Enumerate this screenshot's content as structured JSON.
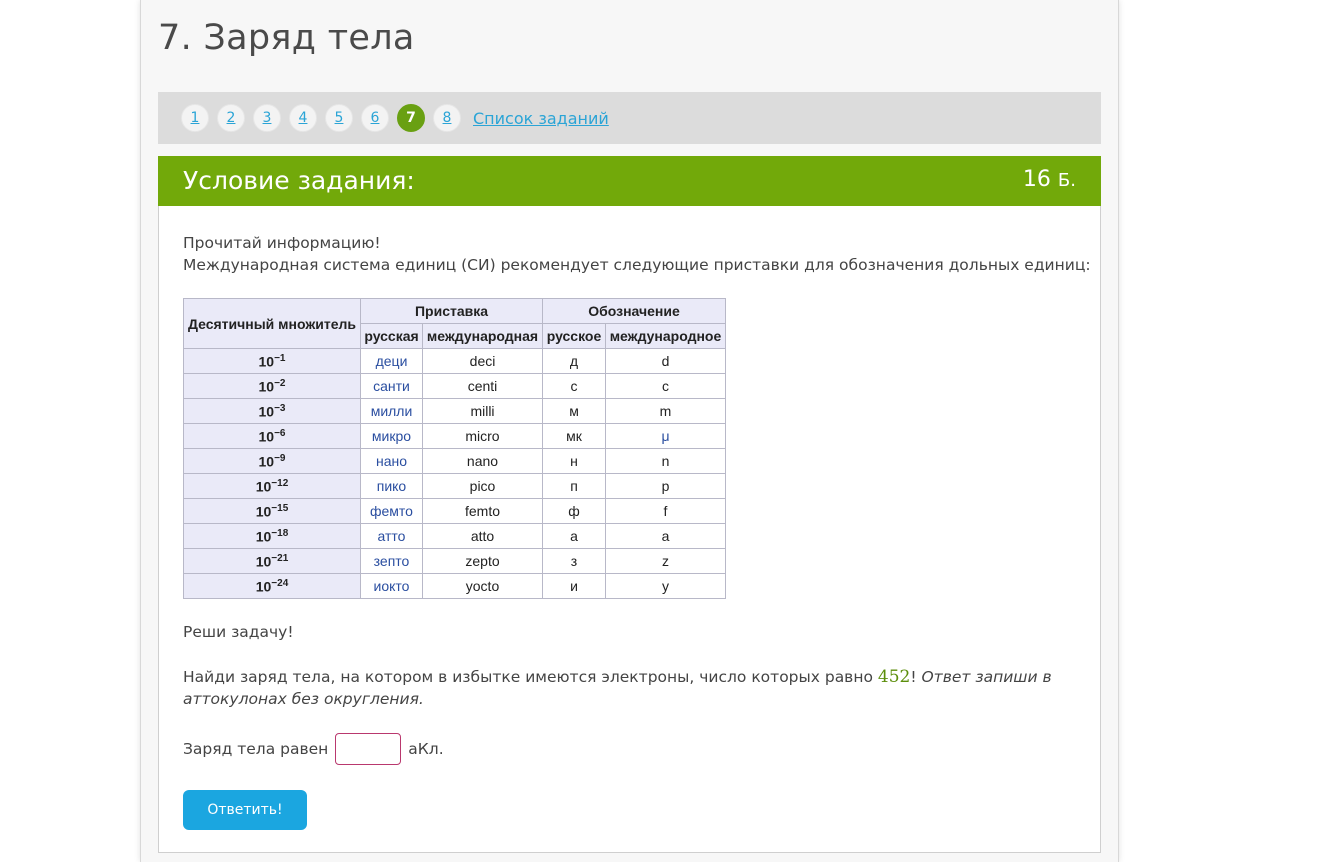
{
  "page": {
    "title": "7. Заряд тела"
  },
  "nav": {
    "items": [
      "1",
      "2",
      "3",
      "4",
      "5",
      "6",
      "7",
      "8"
    ],
    "active_index": 6,
    "list_link": "Список заданий"
  },
  "task": {
    "header_title": "Условие задания:",
    "score_value": "16",
    "score_unit": "Б.",
    "intro_line1": "Прочитай информацию!",
    "intro_line2": "Международная система единиц (СИ) рекомендует следующие приставки для обозначения дольных единиц:",
    "table": {
      "headers": {
        "multiplier": "Десятичный множитель",
        "prefix": "Приставка",
        "symbol": "Обозначение",
        "prefix_ru": "русская",
        "prefix_int": "международная",
        "symbol_ru": "русское",
        "symbol_int": "международное"
      },
      "rows": [
        {
          "base": "10",
          "exp": "−1",
          "ru": "деци",
          "int": "deci",
          "sym_ru": "д",
          "sym_int": "d"
        },
        {
          "base": "10",
          "exp": "−2",
          "ru": "санти",
          "int": "centi",
          "sym_ru": "с",
          "sym_int": "c"
        },
        {
          "base": "10",
          "exp": "−3",
          "ru": "милли",
          "int": "milli",
          "sym_ru": "м",
          "sym_int": "m"
        },
        {
          "base": "10",
          "exp": "−6",
          "ru": "микро",
          "int": "micro",
          "sym_ru": "мк",
          "sym_int": "μ"
        },
        {
          "base": "10",
          "exp": "−9",
          "ru": "нано",
          "int": "nano",
          "sym_ru": "н",
          "sym_int": "n"
        },
        {
          "base": "10",
          "exp": "−12",
          "ru": "пико",
          "int": "pico",
          "sym_ru": "п",
          "sym_int": "p"
        },
        {
          "base": "10",
          "exp": "−15",
          "ru": "фемто",
          "int": "femto",
          "sym_ru": "ф",
          "sym_int": "f"
        },
        {
          "base": "10",
          "exp": "−18",
          "ru": "атто",
          "int": "atto",
          "sym_ru": "а",
          "sym_int": "a"
        },
        {
          "base": "10",
          "exp": "−21",
          "ru": "зепто",
          "int": "zepto",
          "sym_ru": "з",
          "sym_int": "z"
        },
        {
          "base": "10",
          "exp": "−24",
          "ru": "иокто",
          "int": "yocto",
          "sym_ru": "и",
          "sym_int": "y"
        }
      ]
    },
    "solve_label": "Реши задачу!",
    "problem_text_before": "Найди заряд тела, на котором в избытке имеются электроны, число которых равно ",
    "problem_number": "452",
    "problem_text_after": "! ",
    "problem_italic": "Ответ запиши в аттокулонах без округления.",
    "answer_label": "Заряд тела равен",
    "answer_value": "",
    "answer_unit": "аКл.",
    "submit_label": "Ответить!"
  },
  "colors": {
    "header_green": "#72a90a",
    "active_nav": "#69a012",
    "link_blue": "#2aa4d6",
    "button_blue": "#1ba6e0",
    "input_border": "#b9386e"
  }
}
